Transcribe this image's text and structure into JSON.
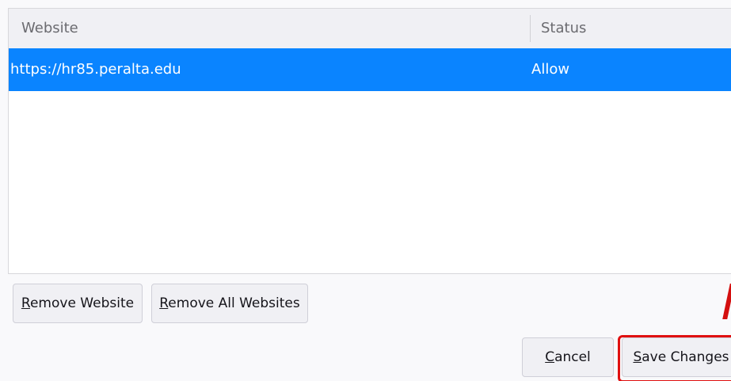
{
  "table": {
    "columns": {
      "website": "Website",
      "status": "Status"
    },
    "rows": [
      {
        "website": "https://hr85.peralta.edu",
        "status": "Allow"
      }
    ]
  },
  "buttons": {
    "remove_website": {
      "accel": "R",
      "rest": "emove Website"
    },
    "remove_all": {
      "accel": "R",
      "rest": "emove All Websites"
    },
    "cancel": {
      "accel": "C",
      "rest": "ancel"
    },
    "save": {
      "accel": "S",
      "rest": "ave Changes"
    }
  },
  "colors": {
    "selected_row": "#0a84ff",
    "highlight": "#e01010"
  }
}
